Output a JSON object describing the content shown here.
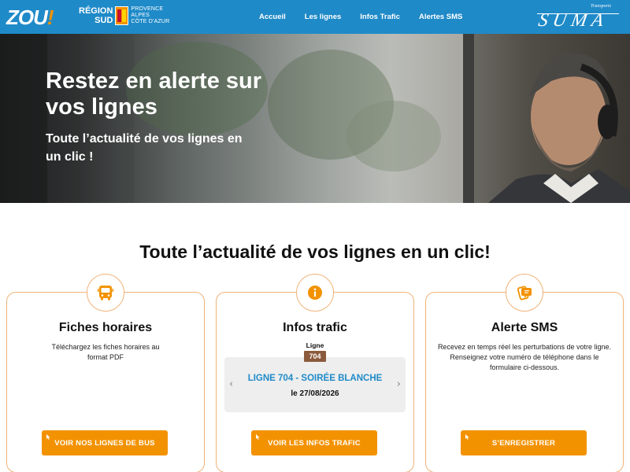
{
  "header": {
    "brand": {
      "zou": "ZOU",
      "zou_mark": "!"
    },
    "region": {
      "name_line1": "RÉGION",
      "name_line2": "SUD",
      "sub_line1": "PROVENCE",
      "sub_line2": "ALPES",
      "sub_line3": "CÔTE D'AZUR"
    },
    "nav": [
      "Accueil",
      "Les lignes",
      "Infos Trafic",
      "Alertes SMS"
    ],
    "suma": {
      "tag": "Transports",
      "name": "SUMA"
    }
  },
  "hero": {
    "title": "Restez en alerte sur vos lignes",
    "subtitle": "Toute l’actualité de vos lignes en un clic !"
  },
  "section": {
    "title": "Toute l’actualité de vos lignes en un clic!"
  },
  "cards": [
    {
      "icon": "bus-icon",
      "title": "Fiches horaires",
      "description": "Téléchargez les fiches horaires au format PDF",
      "button": "VOIR NOS LIGNES DE BUS"
    },
    {
      "icon": "info-icon",
      "title": "Infos trafic",
      "ligne_label": "Ligne",
      "ligne_number": "704",
      "item_title": "LIGNE 704 - SOIRÉE BLANCHE",
      "item_date": "le 27/08/2026",
      "button": "VOIR LES INFOS TRAFIC"
    },
    {
      "icon": "sms-icon",
      "title": "Alerte SMS",
      "description": "Recevez en temps réel les perturbations de votre ligne. Renseignez votre numéro de téléphone dans le formulaire ci-dessous.",
      "button": "S’ENREGISTRER"
    }
  ],
  "colors": {
    "header": "#1f8ac8",
    "accent": "#f39200",
    "badge": "#8b5a3c",
    "link": "#1f8ac8"
  }
}
